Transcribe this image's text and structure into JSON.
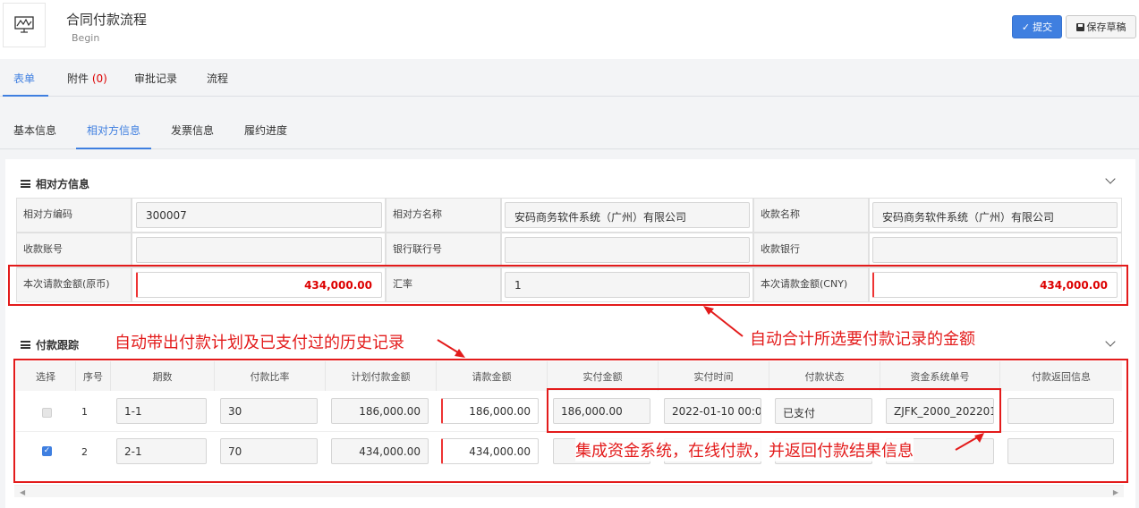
{
  "header": {
    "title": "合同付款流程",
    "subtitle": "Begin",
    "app_icon": "chart-board-icon",
    "submit_label": "提交",
    "save_draft_label": "保存草稿"
  },
  "tabs_main": [
    {
      "label": "表单",
      "active": true
    },
    {
      "label": "附件",
      "badge": "(0)",
      "active": false
    },
    {
      "label": "审批记录",
      "active": false
    },
    {
      "label": "流程",
      "active": false
    }
  ],
  "tabs_sub": [
    {
      "label": "基本信息",
      "active": false
    },
    {
      "label": "相对方信息",
      "active": true
    },
    {
      "label": "发票信息",
      "active": false
    },
    {
      "label": "履约进度",
      "active": false
    }
  ],
  "counterparty": {
    "section_title": "相对方信息",
    "fields": {
      "code_label": "相对方编码",
      "code_value": "300007",
      "name_label": "相对方名称",
      "name_value": "安码商务软件系统（广州）有限公司",
      "payee_label": "收款名称",
      "payee_value": "安码商务软件系统（广州）有限公司",
      "account_label": "收款账号",
      "account_value": "",
      "bank_no_label": "银行联行号",
      "bank_no_value": "",
      "bank_label": "收款银行",
      "bank_value": "",
      "amount_orig_label": "本次请款金额(原币)",
      "amount_orig_value": "434,000.00",
      "rate_label": "汇率",
      "rate_value": "1",
      "amount_cny_label": "本次请款金额(CNY)",
      "amount_cny_value": "434,000.00"
    }
  },
  "payment": {
    "section_title": "付款跟踪",
    "columns": [
      "选择",
      "序号",
      "期数",
      "付款比率",
      "计划付款金额",
      "请款金额",
      "实付金额",
      "实付时间",
      "付款状态",
      "资金系统单号",
      "付款返回信息"
    ],
    "rows": [
      {
        "selected": true,
        "disabled": true,
        "seq": "1",
        "period": "1-1",
        "ratio": "30",
        "planned": "186,000.00",
        "request": "186,000.00",
        "paid": "186,000.00",
        "paid_time": "2022-01-10 00:0",
        "status": "已支付",
        "fund_no": "ZJFK_2000_202201",
        "return_info": ""
      },
      {
        "selected": true,
        "disabled": false,
        "seq": "2",
        "period": "2-1",
        "ratio": "70",
        "planned": "434,000.00",
        "request": "434,000.00",
        "paid": "",
        "paid_time": "",
        "status": "",
        "fund_no": "",
        "return_info": ""
      }
    ]
  },
  "annotations": {
    "auto_sum": "自动合计所选要付款记录的金额",
    "auto_history": "自动带出付款计划及已支付过的历史记录",
    "fund_system": "集成资金系统，在线付款，并返回付款结果信息"
  },
  "colors": {
    "accent": "#3f7fe0",
    "annotation": "#e31b1b",
    "required": "#e33333"
  }
}
